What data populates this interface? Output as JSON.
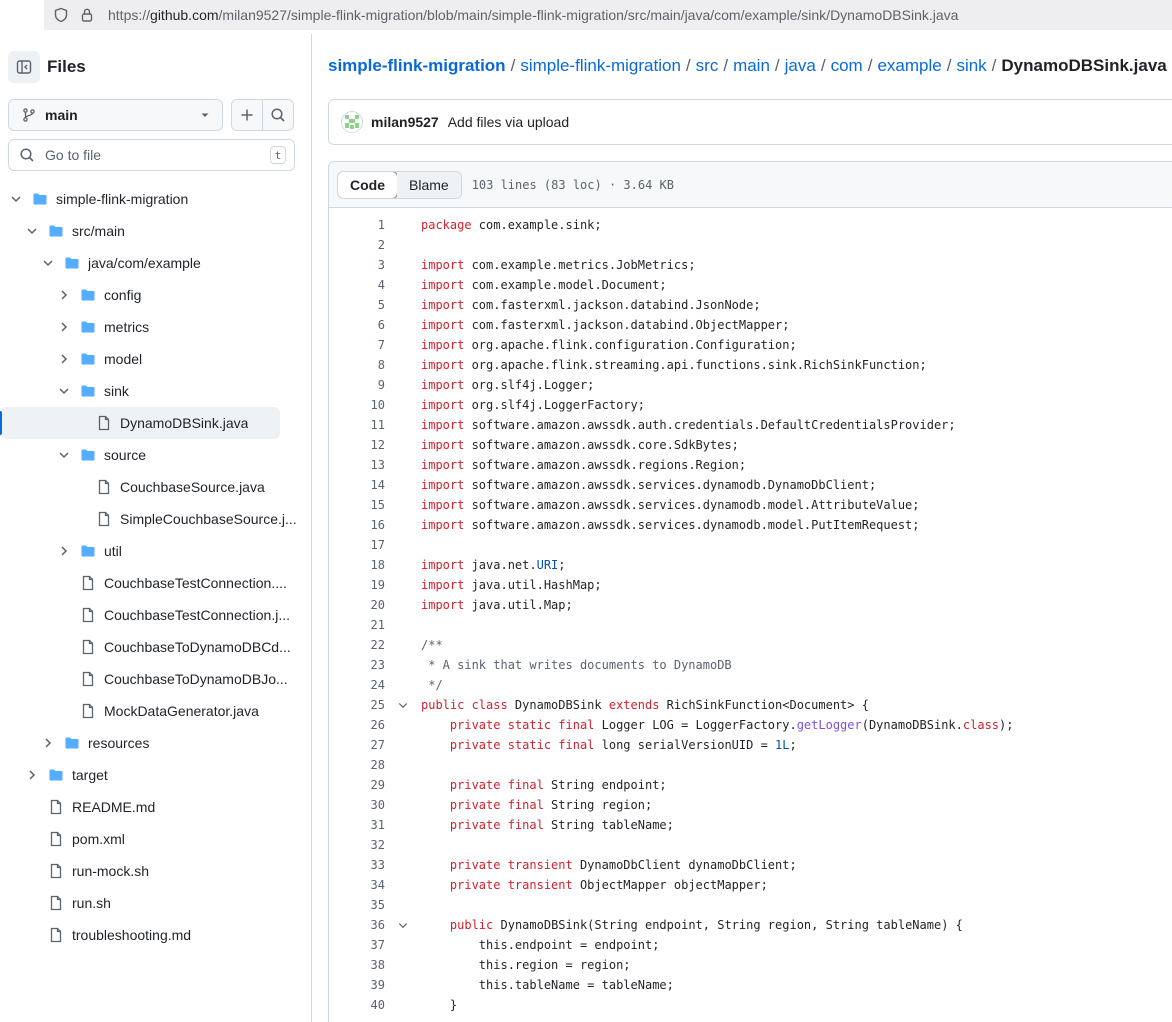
{
  "url": {
    "prefix": "https://",
    "host": "github.com",
    "path": "/milan9527/simple-flink-migration/blob/main/simple-flink-migration/src/main/java/com/example/sink/DynamoDBSink.java"
  },
  "sidebar": {
    "title": "Files",
    "branch": "main",
    "goto_placeholder": "Go to file",
    "goto_kbd": "t",
    "tree": [
      {
        "depth": 0,
        "type": "dir",
        "open": true,
        "name": "simple-flink-migration"
      },
      {
        "depth": 1,
        "type": "dir",
        "open": true,
        "name": "src/main"
      },
      {
        "depth": 2,
        "type": "dir",
        "open": true,
        "name": "java/com/example"
      },
      {
        "depth": 3,
        "type": "dir",
        "open": false,
        "name": "config"
      },
      {
        "depth": 3,
        "type": "dir",
        "open": false,
        "name": "metrics"
      },
      {
        "depth": 3,
        "type": "dir",
        "open": false,
        "name": "model"
      },
      {
        "depth": 3,
        "type": "dir",
        "open": true,
        "name": "sink"
      },
      {
        "depth": 4,
        "type": "file",
        "name": "DynamoDBSink.java",
        "selected": true
      },
      {
        "depth": 3,
        "type": "dir",
        "open": true,
        "name": "source"
      },
      {
        "depth": 4,
        "type": "file",
        "name": "CouchbaseSource.java"
      },
      {
        "depth": 4,
        "type": "file",
        "name": "SimpleCouchbaseSource.j..."
      },
      {
        "depth": 3,
        "type": "dir",
        "open": false,
        "name": "util"
      },
      {
        "depth": 3,
        "type": "file",
        "name": "CouchbaseTestConnection...."
      },
      {
        "depth": 3,
        "type": "file",
        "name": "CouchbaseTestConnection.j..."
      },
      {
        "depth": 3,
        "type": "file",
        "name": "CouchbaseToDynamoDBCd..."
      },
      {
        "depth": 3,
        "type": "file",
        "name": "CouchbaseToDynamoDBJo..."
      },
      {
        "depth": 3,
        "type": "file",
        "name": "MockDataGenerator.java"
      },
      {
        "depth": 2,
        "type": "dir",
        "open": false,
        "name": "resources"
      },
      {
        "depth": 1,
        "type": "dir",
        "open": false,
        "name": "target"
      },
      {
        "depth": 1,
        "type": "file",
        "name": "README.md"
      },
      {
        "depth": 1,
        "type": "file",
        "name": "pom.xml"
      },
      {
        "depth": 1,
        "type": "file",
        "name": "run-mock.sh"
      },
      {
        "depth": 1,
        "type": "file",
        "name": "run.sh"
      },
      {
        "depth": 1,
        "type": "file",
        "name": "troubleshooting.md"
      }
    ]
  },
  "breadcrumb": {
    "repo": "simple-flink-migration",
    "parts": [
      "simple-flink-migration",
      "src",
      "main",
      "java",
      "com",
      "example",
      "sink"
    ],
    "current": "DynamoDBSink.java"
  },
  "commit": {
    "user": "milan9527",
    "message": "Add files via upload"
  },
  "code_view": {
    "tab_code": "Code",
    "tab_blame": "Blame",
    "meta": "103 lines (83 loc) · 3.64 KB"
  },
  "code_lines": [
    {
      "n": "1",
      "t": [
        [
          "kw",
          "package"
        ],
        [
          "src",
          " com.example.sink;"
        ]
      ]
    },
    {
      "n": "2",
      "t": []
    },
    {
      "n": "3",
      "t": [
        [
          "kw",
          "import"
        ],
        [
          "src",
          " com.example.metrics.JobMetrics;"
        ]
      ]
    },
    {
      "n": "4",
      "t": [
        [
          "kw",
          "import"
        ],
        [
          "src",
          " com.example.model.Document;"
        ]
      ]
    },
    {
      "n": "5",
      "t": [
        [
          "kw",
          "import"
        ],
        [
          "src",
          " com.fasterxml.jackson.databind.JsonNode;"
        ]
      ]
    },
    {
      "n": "6",
      "t": [
        [
          "kw",
          "import"
        ],
        [
          "src",
          " com.fasterxml.jackson.databind.ObjectMapper;"
        ]
      ]
    },
    {
      "n": "7",
      "t": [
        [
          "kw",
          "import"
        ],
        [
          "src",
          " org.apache.flink.configuration.Configuration;"
        ]
      ]
    },
    {
      "n": "8",
      "t": [
        [
          "kw",
          "import"
        ],
        [
          "src",
          " org.apache.flink.streaming.api.functions.sink.RichSinkFunction;"
        ]
      ]
    },
    {
      "n": "9",
      "t": [
        [
          "kw",
          "import"
        ],
        [
          "src",
          " org.slf4j.Logger;"
        ]
      ]
    },
    {
      "n": "10",
      "t": [
        [
          "kw",
          "import"
        ],
        [
          "src",
          " org.slf4j.LoggerFactory;"
        ]
      ]
    },
    {
      "n": "11",
      "t": [
        [
          "kw",
          "import"
        ],
        [
          "src",
          " software.amazon.awssdk.auth.credentials.DefaultCredentialsProvider;"
        ]
      ]
    },
    {
      "n": "12",
      "t": [
        [
          "kw",
          "import"
        ],
        [
          "src",
          " software.amazon.awssdk.core.SdkBytes;"
        ]
      ]
    },
    {
      "n": "13",
      "t": [
        [
          "kw",
          "import"
        ],
        [
          "src",
          " software.amazon.awssdk.regions.Region;"
        ]
      ]
    },
    {
      "n": "14",
      "t": [
        [
          "kw",
          "import"
        ],
        [
          "src",
          " software.amazon.awssdk.services.dynamodb.DynamoDbClient;"
        ]
      ]
    },
    {
      "n": "15",
      "t": [
        [
          "kw",
          "import"
        ],
        [
          "src",
          " software.amazon.awssdk.services.dynamodb.model.AttributeValue;"
        ]
      ]
    },
    {
      "n": "16",
      "t": [
        [
          "kw",
          "import"
        ],
        [
          "src",
          " software.amazon.awssdk.services.dynamodb.model.PutItemRequest;"
        ]
      ]
    },
    {
      "n": "17",
      "t": []
    },
    {
      "n": "18",
      "t": [
        [
          "kw",
          "import"
        ],
        [
          "src",
          " java.net."
        ],
        [
          "nu",
          "URI"
        ],
        [
          "src",
          ";"
        ]
      ]
    },
    {
      "n": "19",
      "t": [
        [
          "kw",
          "import"
        ],
        [
          "src",
          " java.util.HashMap;"
        ]
      ]
    },
    {
      "n": "20",
      "t": [
        [
          "kw",
          "import"
        ],
        [
          "src",
          " java.util.Map;"
        ]
      ]
    },
    {
      "n": "21",
      "t": []
    },
    {
      "n": "22",
      "t": [
        [
          "cm",
          "/**"
        ]
      ]
    },
    {
      "n": "23",
      "t": [
        [
          "cm",
          " * A sink that writes documents to DynamoDB"
        ]
      ]
    },
    {
      "n": "24",
      "t": [
        [
          "cm",
          " */"
        ]
      ]
    },
    {
      "n": "25",
      "fold": true,
      "t": [
        [
          "kw",
          "public class"
        ],
        [
          "src",
          " DynamoDBSink "
        ],
        [
          "kw",
          "extends"
        ],
        [
          "src",
          " RichSinkFunction<Document> {"
        ]
      ]
    },
    {
      "n": "26",
      "t": [
        [
          "src",
          "    "
        ],
        [
          "kw",
          "private static final"
        ],
        [
          "src",
          " Logger LOG = LoggerFactory."
        ],
        [
          "fn",
          "getLogger"
        ],
        [
          "src",
          "(DynamoDBSink."
        ],
        [
          "kw",
          "class"
        ],
        [
          "src",
          ");"
        ]
      ]
    },
    {
      "n": "27",
      "t": [
        [
          "src",
          "    "
        ],
        [
          "kw",
          "private static final"
        ],
        [
          "src",
          " long serialVersionUID = "
        ],
        [
          "nu",
          "1L"
        ],
        [
          "src",
          ";"
        ]
      ]
    },
    {
      "n": "28",
      "t": []
    },
    {
      "n": "29",
      "t": [
        [
          "src",
          "    "
        ],
        [
          "kw",
          "private final"
        ],
        [
          "src",
          " String endpoint;"
        ]
      ]
    },
    {
      "n": "30",
      "t": [
        [
          "src",
          "    "
        ],
        [
          "kw",
          "private final"
        ],
        [
          "src",
          " String region;"
        ]
      ]
    },
    {
      "n": "31",
      "t": [
        [
          "src",
          "    "
        ],
        [
          "kw",
          "private final"
        ],
        [
          "src",
          " String tableName;"
        ]
      ]
    },
    {
      "n": "32",
      "t": []
    },
    {
      "n": "33",
      "t": [
        [
          "src",
          "    "
        ],
        [
          "kw",
          "private transient"
        ],
        [
          "src",
          " DynamoDbClient dynamoDbClient;"
        ]
      ]
    },
    {
      "n": "34",
      "t": [
        [
          "src",
          "    "
        ],
        [
          "kw",
          "private transient"
        ],
        [
          "src",
          " ObjectMapper objectMapper;"
        ]
      ]
    },
    {
      "n": "35",
      "t": []
    },
    {
      "n": "36",
      "fold": true,
      "t": [
        [
          "src",
          "    "
        ],
        [
          "kw",
          "public"
        ],
        [
          "src",
          " DynamoDBSink(String endpoint, String region, String tableName) {"
        ]
      ]
    },
    {
      "n": "37",
      "t": [
        [
          "src",
          "        this.endpoint = endpoint;"
        ]
      ]
    },
    {
      "n": "38",
      "t": [
        [
          "src",
          "        this.region = region;"
        ]
      ]
    },
    {
      "n": "39",
      "t": [
        [
          "src",
          "        this.tableName = tableName;"
        ]
      ]
    },
    {
      "n": "40",
      "t": [
        [
          "src",
          "    }"
        ]
      ]
    }
  ],
  "colors": {
    "link": "#0969da",
    "folder": "#54aeff",
    "keyword": "#cf222e"
  }
}
